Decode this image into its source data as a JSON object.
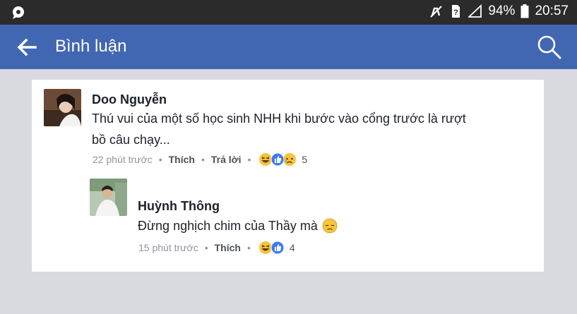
{
  "status_bar": {
    "battery": "94%",
    "time": "20:57",
    "icons": [
      "chat-bubble-icon",
      "muted-icon",
      "sim-icon",
      "signal-icon",
      "battery-icon"
    ]
  },
  "app_bar": {
    "title": "Bình luận",
    "back_icon": "arrow-left-icon",
    "search_icon": "search-icon"
  },
  "comments": [
    {
      "author": "Doo Nguyễn",
      "text_line1": "Thú vui của một số học sinh NHH khi bước vào cổng trước là rượt",
      "text_line2": "bồ câu chạy...",
      "time": "22 phút trước",
      "like_label": "Thích",
      "reply_label": "Trả lời",
      "separator": "•",
      "reactions": [
        "haha-icon",
        "like-icon",
        "sad-icon"
      ],
      "reaction_count": "5"
    },
    {
      "author": "Huỳnh Thông",
      "text": "Đừng nghịch chim của Thầy mà",
      "time": "15 phút trước",
      "like_label": "Thích",
      "separator": "•",
      "reactions": [
        "haha-icon",
        "like-icon"
      ],
      "reaction_count": "4"
    }
  ],
  "colors": {
    "brand": "#4267b2",
    "status_bar": "#2b2b2b",
    "background": "#d9dadf",
    "text": "#1d2129",
    "meta": "#90949c"
  }
}
